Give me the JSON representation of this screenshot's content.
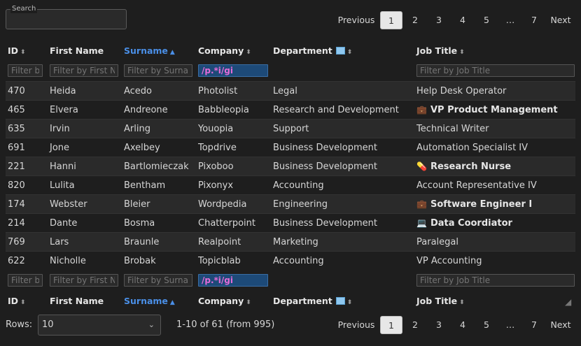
{
  "search": {
    "label": "Search",
    "value": ""
  },
  "pagination": {
    "previous": "Previous",
    "next": "Next",
    "pages": [
      "1",
      "2",
      "3",
      "4",
      "5",
      "…",
      "7"
    ],
    "active_page": "1"
  },
  "columns": {
    "id": "ID",
    "first_name": "First Name",
    "surname": "Surname",
    "company": "Company",
    "department": "Department",
    "job_title": "Job Title"
  },
  "sorted_column": "Surname",
  "filters": {
    "id_placeholder": "Filter by ID",
    "first_name_placeholder": "Filter by First Name",
    "surname_placeholder": "Filter by Surname",
    "company_value": "/p.*i/gi",
    "job_title_placeholder": "Filter by Job Title"
  },
  "rows": [
    {
      "id": "470",
      "first": "Heida",
      "surname": "Acedo",
      "company": "Photolist",
      "dept": "Legal",
      "job": "Help Desk Operator",
      "job_bold": false,
      "job_icon": ""
    },
    {
      "id": "465",
      "first": "Elvera",
      "surname": "Andreone",
      "company": "Babbleopia",
      "dept": "Research and Development",
      "job": "VP Product Management",
      "job_bold": true,
      "job_icon": "briefcase-icon"
    },
    {
      "id": "635",
      "first": "Irvin",
      "surname": "Arling",
      "company": "Youopia",
      "dept": "Support",
      "job": "Technical Writer",
      "job_bold": false,
      "job_icon": ""
    },
    {
      "id": "691",
      "first": "Jone",
      "surname": "Axelbey",
      "company": "Topdrive",
      "dept": "Business Development",
      "job": "Automation Specialist IV",
      "job_bold": false,
      "job_icon": ""
    },
    {
      "id": "221",
      "first": "Hanni",
      "surname": "Bartlomieczak",
      "company": "Pixoboo",
      "dept": "Business Development",
      "job": "Research Nurse",
      "job_bold": true,
      "job_icon": "pill-icon"
    },
    {
      "id": "820",
      "first": "Lulita",
      "surname": "Bentham",
      "company": "Pixonyx",
      "dept": "Accounting",
      "job": "Account Representative IV",
      "job_bold": false,
      "job_icon": ""
    },
    {
      "id": "174",
      "first": "Webster",
      "surname": "Bleier",
      "company": "Wordpedia",
      "dept": "Engineering",
      "job": "Software Engineer I",
      "job_bold": true,
      "job_icon": "briefcase-icon"
    },
    {
      "id": "214",
      "first": "Dante",
      "surname": "Bosma",
      "company": "Chatterpoint",
      "dept": "Business Development",
      "job": "Data Coordiator",
      "job_bold": true,
      "job_icon": "laptop-icon"
    },
    {
      "id": "769",
      "first": "Lars",
      "surname": "Braunle",
      "company": "Realpoint",
      "dept": "Marketing",
      "job": "Paralegal",
      "job_bold": false,
      "job_icon": ""
    },
    {
      "id": "622",
      "first": "Nicholle",
      "surname": "Brobak",
      "company": "Topicblab",
      "dept": "Accounting",
      "job": "VP Accounting",
      "job_bold": false,
      "job_icon": ""
    }
  ],
  "footer": {
    "rows_label": "Rows:",
    "rows_value": "10",
    "count_text": "1-10 of 61 (from 995)"
  },
  "colors": {
    "sorted": "#4a8fe7",
    "filter_active_bg": "#1d4a78",
    "filter_active_text": "#e46ad8"
  }
}
